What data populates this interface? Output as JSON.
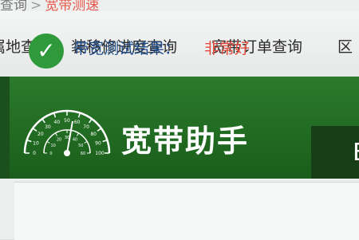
{
  "breadcrumb": {
    "parent": "查询",
    "separator": ">",
    "current": "宽带测速"
  },
  "nav": {
    "items": [
      {
        "label": "属地查询"
      },
      {
        "label": "装移修进度查询"
      },
      {
        "label": "宽带订单查询"
      },
      {
        "label": "区"
      }
    ]
  },
  "banner": {
    "title": "宽带助手",
    "gauge_outer_ticks": [
      "0",
      "10",
      "20",
      "30",
      "40",
      "50",
      "60",
      "70",
      "80",
      "90",
      "100"
    ],
    "gauge_inner_ticks": [
      "0",
      "10",
      "20",
      "30",
      "40",
      "50",
      "60"
    ],
    "right_panel_letter": "E"
  },
  "result": {
    "label": "带宽测试结果：",
    "value": "非常好"
  },
  "colors": {
    "banner_green": "#216b22",
    "result_label": "#1f4d8c",
    "result_value": "#e64a3b",
    "check_green": "#2f9a3b"
  }
}
